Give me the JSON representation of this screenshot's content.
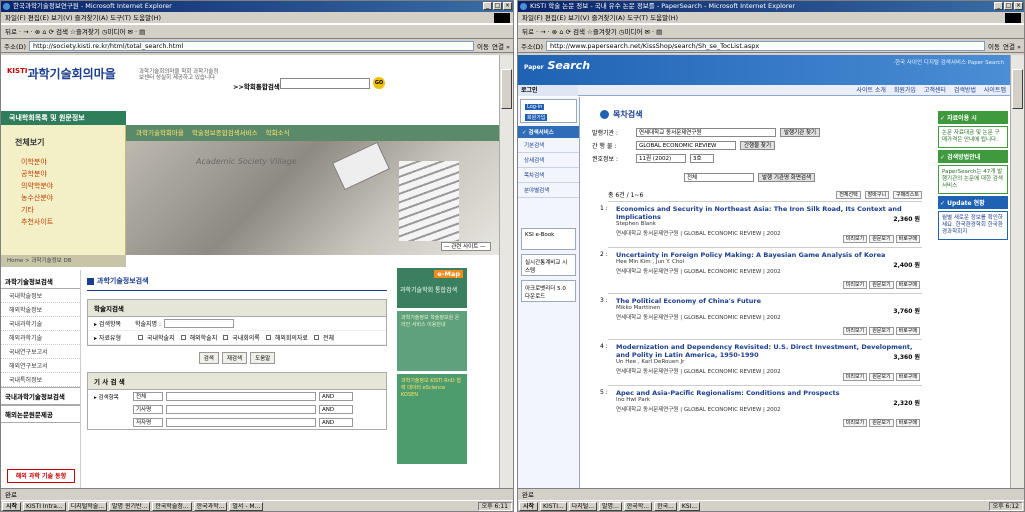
{
  "left_window": {
    "title": "한국과학기술정보연구원 - Microsoft Internet Explorer",
    "menu": "파일(F)  편집(E)  보기(V)  즐겨찾기(A)  도구(T)  도움말(H)",
    "toolbar": "뒤로 ·  →  ·  ⊗  ⌂  ⟳  검색  ☆즐겨찾기  ◷미디어  ✉ ·  ▤",
    "address_label": "주소(D)",
    "address": "http://society.kisti.re.kr/html/total_search.html",
    "go_label": "이동",
    "links_label": "연결 »",
    "status": "완료",
    "site": {
      "logo": "과학기술회의마을",
      "logo_prefix": "KISTI",
      "slogan": "과학기술회의마을 학회 과학기술정보센터 성실히 제공하고 있습니다",
      "search_label": ">>학회통합검색",
      "go_btn": "GO",
      "bluebar": "국내학회목록 및 원문정보",
      "nav": [
        "과학기술학회마을",
        "학술정보종합검색서비스",
        "학회소식"
      ],
      "left_menu_title": "전체보기",
      "left_menu": [
        "이학분야",
        "공학분야",
        "의약학분야",
        "농수산분야",
        "기타",
        "추천사이트"
      ],
      "hero_text": "Academic Society Village",
      "hero_select": "— 관련 사이트 —",
      "breadcrumb": "Home > 과학기술정보 DB",
      "side_heading1": "과학기술정보검색",
      "side_items": [
        "국내학술정보",
        "해외학술정보",
        "국내과학기술",
        "해외과학기술",
        "국내연구보고서",
        "해외연구보고서",
        "국내특허정보"
      ],
      "side_heading2": "국내과학기술정보검색",
      "side_heading3": "해외논문원문제공",
      "abroad": "해외 과학 기술 동향",
      "main_title": "과학기술정보검색",
      "box1_title": "학술지검색",
      "row1_label": "▸ 검색항목",
      "row1_field": "학술지명 :",
      "row2_label": "▸ 자료유형",
      "row2_checks": [
        "국내학술지",
        "해외학술지",
        "국내회의록",
        "해외회의자료",
        "전체"
      ],
      "buttons": [
        "검색",
        "재검색",
        "도움말"
      ],
      "box2_title": "기 사 검 색",
      "article_rows": [
        {
          "label": "▸ 검색항목",
          "field": "전체",
          "op": "AND"
        },
        {
          "label": "",
          "field": "기사명",
          "op": "AND"
        },
        {
          "label": "",
          "field": "저자명",
          "op": "AND"
        }
      ],
      "emap_label": "e-Map",
      "emap_top": "과학기술학회 통합검색",
      "emap_mid": "과학기술정보 학술정보원 온라인 서비스 이용안내",
      "emap_bot": "과학기술정보 KISTI RnD 협력 데이터 eScience KOSEN"
    }
  },
  "right_window": {
    "title": "KISTI 학술 논문 정보 - 국내 유수 논문 정보를 - PaperSearch - Microsoft Internet Explorer",
    "menu": "파일(F)  편집(E)  보기(V)  즐겨찾기(A)  도구(T)  도움말(H)",
    "toolbar": "뒤로 ·  →  ·  ⊗  ⌂  ⟳  검색  ☆즐겨찾기  ◷미디어  ✉ ·  ▤",
    "address_label": "주소(D)",
    "address": "http://www.papersearch.net/KissShop/search/Sh_se_TocList.aspx",
    "go_label": "이동",
    "links_label": "연결 »",
    "status": "완료",
    "site": {
      "logo": "Search",
      "logo_prefix": "Paper",
      "toplinks": "·한국 사이언 디지털 검색서비스 Paper Search",
      "login": "로그인",
      "nav": [
        "사이트 소개",
        "회원가입",
        "고객센터",
        "검색방법",
        "사이트맵"
      ],
      "left_nav_title": "✓ 검색서비스",
      "left_nav": [
        "기본검색",
        "상세검색",
        "목차검색",
        "분야별검색"
      ],
      "login_btns": [
        "Log-in",
        "회원가입"
      ],
      "side_boxes": [
        "KSI e-Book",
        "실시간통계비교 시스템",
        "아크로벳리더 5.0 다운로드"
      ],
      "main_title": "목차검색",
      "form": [
        {
          "label": "발행기관 :",
          "value": "연세대학교 동서문제연구원",
          "btn": "발행기관 찾기"
        },
        {
          "label": "간 행 물 :",
          "value": "GLOBAL ECONOMIC REVIEW",
          "btn": "간행물 찾기"
        },
        {
          "label": "권호정보 :",
          "value": "11권 (2002)",
          "value2": "3호",
          "btn": ""
        }
      ],
      "issue_select": "전체",
      "issue_btn": "발행 기관명 화면검색",
      "count": "총 6건 / 1~6",
      "actions": [
        "전체선택",
        "장바구니",
        "구매리스트"
      ],
      "results": [
        {
          "num": "1 :",
          "title": "Economics and Security in Northeast Asia: The Iron Silk Road, Its Context and Implications",
          "author": "Stephen Blank",
          "price": "2,360 원",
          "source": "연세대학교 동서문제연구원 | GLOBAL ECONOMIC REVIEW | 2002"
        },
        {
          "num": "2 :",
          "title": "Uncertainty in Foreign Policy Making: A Bayesian Game Analysis of Korea",
          "author": "Hee Min Kim , Jun Y. Choi",
          "price": "2,400 원",
          "source": "연세대학교 동서문제연구원 | GLOBAL ECONOMIC REVIEW | 2002"
        },
        {
          "num": "3 :",
          "title": "The Political Economy of China's Future",
          "author": "Mikko Marttinen",
          "price": "3,760 원",
          "source": "연세대학교 동서문제연구원 | GLOBAL ECONOMIC REVIEW | 2002"
        },
        {
          "num": "4 :",
          "title": "Modernization and Dependency Revisited: U.S. Direct Investment, Development, and Polity in Latin America, 1950-1990",
          "author": "Un Hee , Karl DeRouen Jr",
          "price": "3,360 원",
          "source": "연세대학교 동서문제연구원 | GLOBAL ECONOMIC REVIEW | 2002"
        },
        {
          "num": "5 :",
          "title": "Apec and Asia-Pacific Regionalism: Conditions and Prospects",
          "author": "Ino Hwi Park",
          "price": "2,320 원",
          "source": "연세대학교 동서문제연구원 | GLOBAL ECONOMIC REVIEW | 2002"
        }
      ],
      "item_ops": [
        "미리보기",
        "원문보기",
        "바로구매"
      ],
      "right_box1_title": "✓ 자료이용 시",
      "right_box1_body": "논문 자료대금 및 논문 구매가격은 안내에 됩니다.",
      "right_box2_title": "✓ 검색방법안내",
      "right_box2_body": "PaperSearch는 47개 발행기관의 논문에 대한 검색서비스",
      "right_box3_title": "✓ Update 현황",
      "right_box3_body": "월별 새로운 정보를 확인하세요. 한국환경학회 한국환경과학회지"
    }
  },
  "taskbar": {
    "start": "시작",
    "tasks_left": [
      "KISTI Intra...",
      "디지털학술...",
      "발명 윈기반...",
      "한국학술정...",
      "한국과학...",
      "멀서 - M..."
    ],
    "tasks_right": [
      "KISTI...",
      "다지털...",
      "발명...",
      "한국학...",
      "한국...",
      "KSI..."
    ],
    "clock_left": "오후 6:11",
    "clock_right": "오후 6:12"
  }
}
